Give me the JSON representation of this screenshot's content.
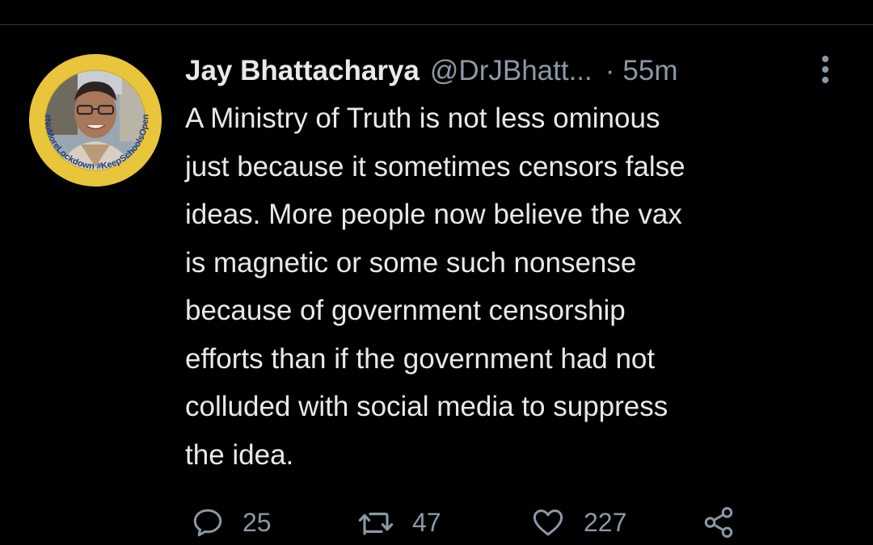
{
  "tweet": {
    "author_name": "Jay Bhattacharya",
    "handle": "@DrJBhatt...",
    "separator": "·",
    "time_ago": "55m",
    "avatar_badge_text": "#NoMoreLockdown #KeepSchoolsOpen",
    "text": "A Ministry of Truth is not less ominous\njust because it sometimes censors false\nideas.  More people now believe the vax\nis magnetic or some such nonsense\nbecause of government censorship\nefforts than if the government had not\ncolluded with social media to suppress\nthe idea."
  },
  "actions": {
    "reply": {
      "icon": "reply-icon",
      "count": "25"
    },
    "retweet": {
      "icon": "retweet-icon",
      "count": "47"
    },
    "like": {
      "icon": "heart-icon",
      "count": "227"
    },
    "share": {
      "icon": "share-icon"
    }
  },
  "colors": {
    "background": "#000000",
    "text": "#e7e9ea",
    "muted": "#8b98a5",
    "divider": "#2f3336",
    "badge_ring": "#e8c53a"
  }
}
